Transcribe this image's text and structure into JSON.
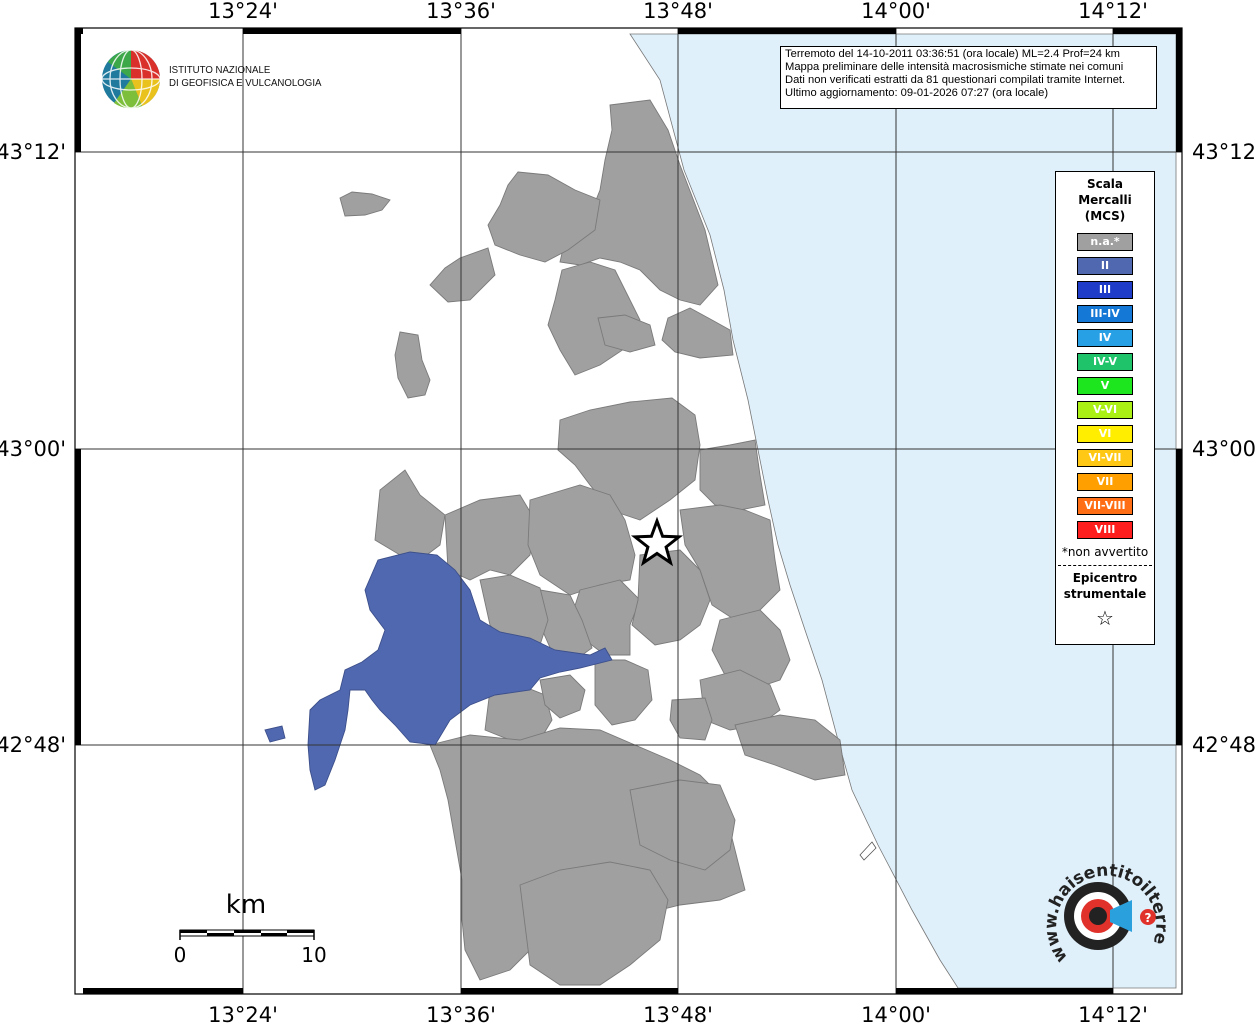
{
  "map": {
    "lon_labels": [
      "13°24'",
      "13°36'",
      "13°48'",
      "14°00'",
      "14°12'"
    ],
    "lat_labels": [
      "43°12'",
      "43°00'",
      "42°48'"
    ],
    "colors": {
      "na": "#a0a0a0",
      "intensity_II": "#5068b0",
      "sea": "#dff0fb",
      "land": "#ffffff"
    }
  },
  "logo": {
    "line1": "ISTITUTO NAZIONALE",
    "line2": "DI GEOFISICA E VULCANOLOGIA"
  },
  "info": {
    "line1": "Terremoto del 14-10-2011 03:36:51 (ora locale) ML=2.4 Prof=24 km",
    "line2": "Mappa preliminare delle intensità macrosismiche stimate nei comuni",
    "line3": "Dati non verificati estratti da 81 questionari compilati tramite Internet.",
    "line4": "Ultimo aggiornamento: 09-01-2026 07:27 (ora locale)"
  },
  "legend": {
    "title1": "Scala",
    "title2": "Mercalli",
    "title3": "(MCS)",
    "items": [
      {
        "label": "n.a.*",
        "color": "#a0a0a0"
      },
      {
        "label": "II",
        "color": "#5068b0"
      },
      {
        "label": "III",
        "color": "#1e3cc8"
      },
      {
        "label": "III-IV",
        "color": "#1478d6"
      },
      {
        "label": "IV",
        "color": "#28a0e6"
      },
      {
        "label": "IV-V",
        "color": "#1ec36a"
      },
      {
        "label": "V",
        "color": "#1ee61e"
      },
      {
        "label": "V-VI",
        "color": "#aaf014"
      },
      {
        "label": "VI",
        "color": "#ffee00"
      },
      {
        "label": "VI-VII",
        "color": "#ffc814"
      },
      {
        "label": "VII",
        "color": "#ffa000"
      },
      {
        "label": "VII-VIII",
        "color": "#ff6e14"
      },
      {
        "label": "VIII",
        "color": "#ff1e1e"
      }
    ],
    "note": "*non avvertito",
    "epicenter1": "Epicentro",
    "epicenter2": "strumentale",
    "star": "☆"
  },
  "scalebar": {
    "unit": "km",
    "min": "0",
    "max": "10"
  },
  "hst_logo": {
    "text": "www.haisentitoilterremoto.it"
  }
}
